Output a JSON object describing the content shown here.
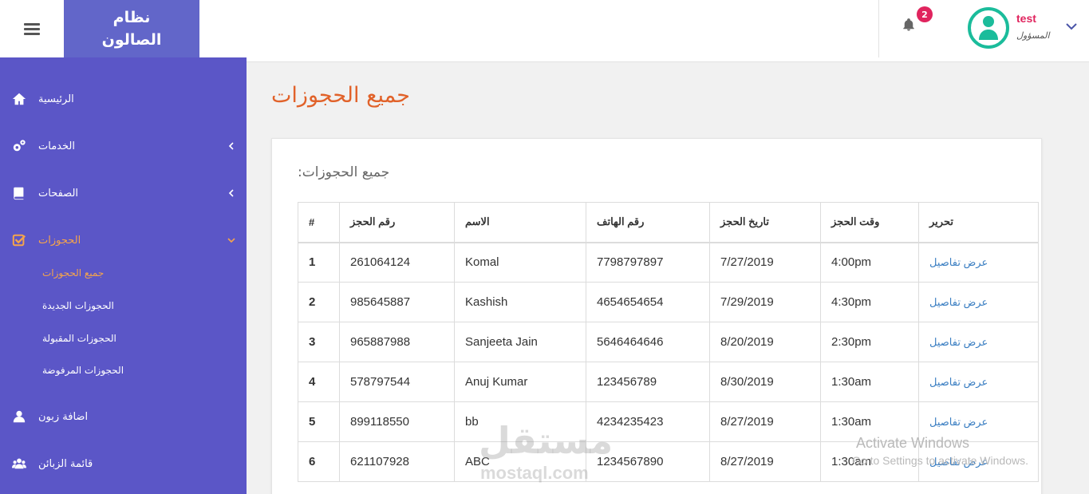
{
  "header": {
    "brand_line1": "نظام",
    "brand_line2": "الصالون",
    "notification_count": "2",
    "user_name": "test",
    "user_role": "المسؤول"
  },
  "sidebar": {
    "items": [
      {
        "label": "الرئيسية",
        "icon": "home-icon"
      },
      {
        "label": "الخدمات",
        "icon": "gears-icon"
      },
      {
        "label": "الصفحات",
        "icon": "book-icon"
      },
      {
        "label": "الحجوزات",
        "icon": "check-square-icon"
      },
      {
        "label": "اضافة زبون",
        "icon": "user-icon"
      },
      {
        "label": "قائمة الزبائن",
        "icon": "users-icon"
      }
    ],
    "sub_items": [
      "جميع الحجوزات",
      "الحجوزات الجديدة",
      "الحجوزات المقبولة",
      "الحجوزات المرفوضة"
    ]
  },
  "main": {
    "page_title": "جميع الحجوزات",
    "card_title": "جميع الحجوزات:"
  },
  "table": {
    "headers": [
      "#",
      "رقم الحجز",
      "الاسم",
      "رقم الهاتف",
      "تاريخ الحجز",
      "وقت الحجز",
      "تحرير"
    ],
    "rows": [
      [
        "1",
        "261064124",
        "Komal",
        "7798797897",
        "7/27/2019",
        "4:00pm",
        "عرض تفاصيل"
      ],
      [
        "2",
        "985645887",
        "Kashish",
        "4654654654",
        "7/29/2019",
        "4:30pm",
        "عرض تفاصيل"
      ],
      [
        "3",
        "965887988",
        "Sanjeeta Jain",
        "5646464646",
        "8/20/2019",
        "2:30pm",
        "عرض تفاصيل"
      ],
      [
        "4",
        "578797544",
        "Anuj Kumar",
        "123456789",
        "8/30/2019",
        "1:30am",
        "عرض تفاصيل"
      ],
      [
        "5",
        "899118550",
        "bb",
        "4234235423",
        "8/27/2019",
        "1:30am",
        "عرض تفاصيل"
      ],
      [
        "6",
        "621107928",
        "ABC",
        "1234567890",
        "8/27/2019",
        "1:30am",
        "عرض تفاصيل"
      ]
    ]
  },
  "watermark": {
    "activate_title": "Activate Windows",
    "activate_sub": "Go to Settings to activate Windows.",
    "logo_text": "مستقل",
    "site_text": "mostaql.com"
  },
  "colors": {
    "sidebar_bg": "#5b56c7",
    "brand_bg": "#6266c9",
    "active_orange": "#f5a44b",
    "title_orange": "#e1622a",
    "link_blue": "#3a7ec2",
    "badge_red": "#e0245e",
    "avatar_green": "#1bbc9b"
  }
}
